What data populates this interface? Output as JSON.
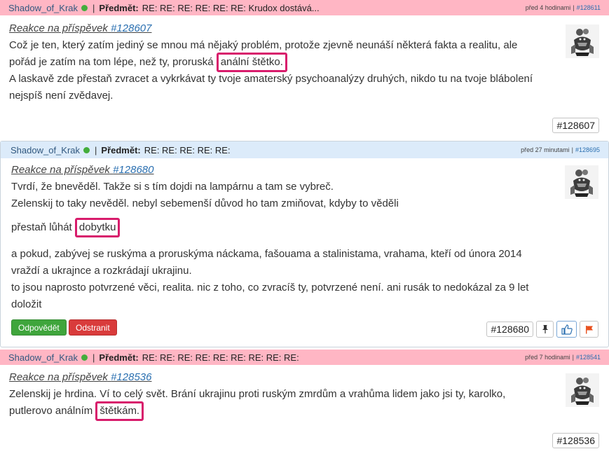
{
  "posts": [
    {
      "author": "Shadow_of_Krak",
      "separator": "|",
      "subject_label": "Předmět:",
      "subject": "RE: RE: RE: RE: RE: RE: Krudox dostává...",
      "time": "před 4 hodinami",
      "id_link": "#128611",
      "reply_prefix": "Reakce na příspěvek",
      "reply_id": "#128607",
      "line1_pre": "Což je ten, který zatím jediný se mnou má nějaký problém, protože zjevně neunáší některá fakta a realitu, ale pořád je zatím na tom lépe, než ty, proruská",
      "line1_highlight": "anální štětko.",
      "line2": "A laskavě zde přestaň zvracet a vykrkávat ty tvoje amaterský psychoanalýzy druhých, nikdo tu na tvoje blábolení nejspíš není zvědavej.",
      "badge": "#128607"
    },
    {
      "author": "Shadow_of_Krak",
      "separator": "|",
      "subject_label": "Předmět:",
      "subject": "RE: RE: RE: RE: RE:",
      "time": "před 27 minutami",
      "id_link": "#128695",
      "reply_prefix": "Reakce na příspěvek",
      "reply_id": "#128680",
      "para1_l1": "Tvrdí, že bnevěděl. Takže si s tím dojdi na lampárnu a tam se vybreč.",
      "para1_l2": "Zelenskij to taky nevěděl. nebyl sebemenší důvod ho tam zmiňovat, kdyby to věděli",
      "para2_pre": "přestaň lůhát",
      "para2_highlight": "dobytku",
      "para3_l1": "a pokud, zabývej se ruskýma a proruskýma náckama, fašouama a stalinistama, vrahama, kteří od února 2014",
      "para3_l2": "vraždí a ukrajnce a rozkrádají ukrajinu.",
      "para3_l3": "to jsou naprosto potvrzené věci, realita. nic z toho, co zvracíš ty, potvrzené není. ani rusák to nedokázal za 9 let",
      "para3_l4": "doložit",
      "reply_button": "Odpovědět",
      "delete_button": "Odstranit",
      "badge": "#128680"
    },
    {
      "author": "Shadow_of_Krak",
      "separator": "|",
      "subject_label": "Předmět:",
      "subject": "RE: RE: RE: RE: RE: RE: RE: RE: RE:",
      "time": "před 7 hodinami",
      "id_link": "#128541",
      "reply_prefix": "Reakce na příspěvek",
      "reply_id": "#128536",
      "line1_pre": "Zelenskij je hrdina. Ví to celý svět. Brání ukrajinu proti ruským zmrdům a vrahůma lidem jako jsi ty, karolko, putlerovo análním",
      "line1_highlight": "štětkám.",
      "badge": "#128536"
    }
  ],
  "icons": {
    "online": "online-status-icon",
    "pin": "pin-icon",
    "like": "thumbs-up-icon",
    "report": "flag-icon",
    "avatar": "creature-avatar"
  },
  "colors": {
    "pink_header": "#ffb6c4",
    "blue_header": "#dcebfa",
    "highlight_border": "#d81c6c",
    "online_green": "#43ad3c",
    "reply_green": "#3fa53c",
    "delete_red": "#d93b3b",
    "flag_orange": "#e8501e",
    "link_blue": "#2a6fb0"
  }
}
